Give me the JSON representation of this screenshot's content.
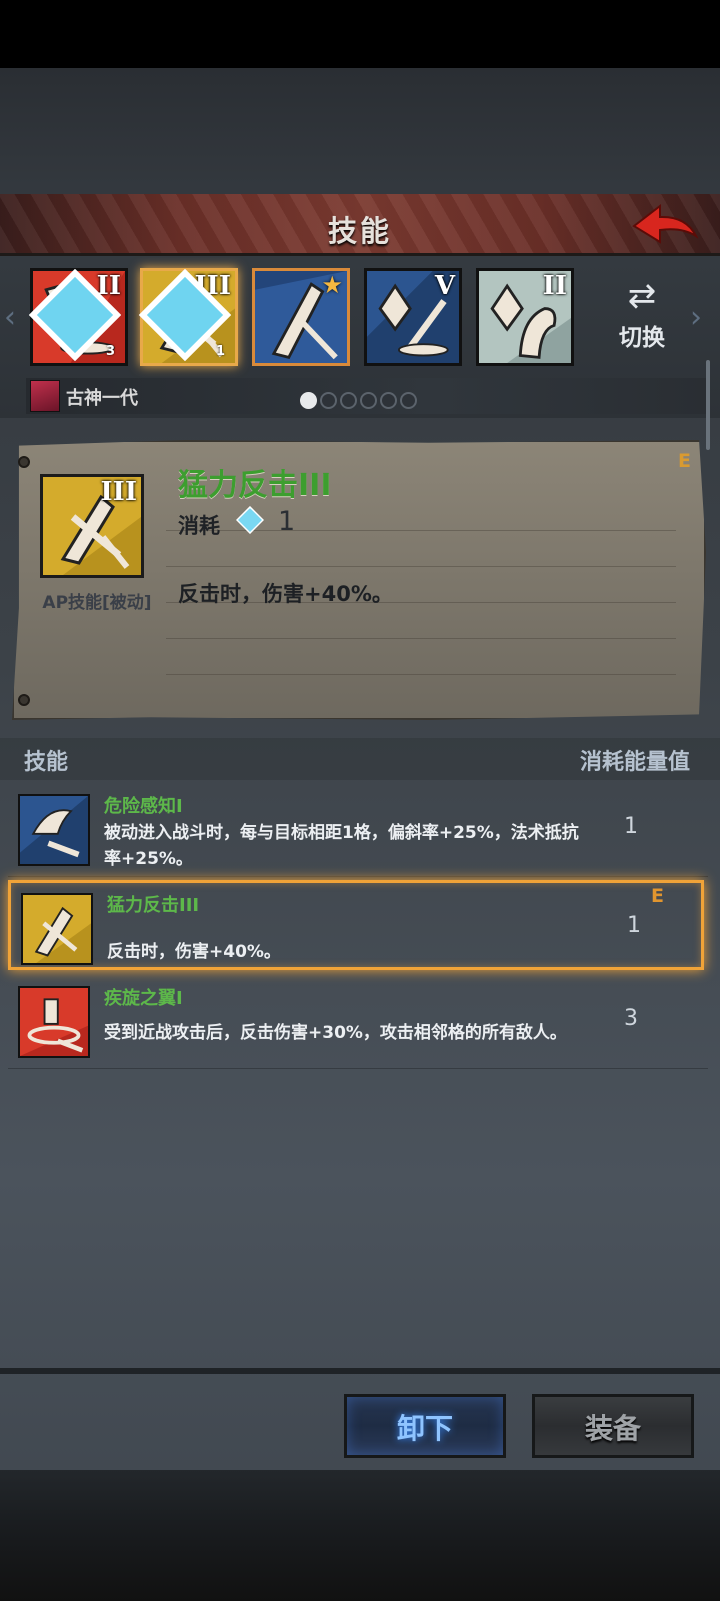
{
  "header": {
    "title": "技能"
  },
  "slots": [
    {
      "numeral": "II",
      "gem": "3",
      "theme": "red"
    },
    {
      "numeral": "III",
      "gem": "1",
      "theme": "gold"
    },
    {
      "numeral": "",
      "gem": "",
      "theme": "blue",
      "star": "★"
    },
    {
      "numeral": "V",
      "gem": "",
      "theme": "blue"
    },
    {
      "numeral": "II",
      "gem": "",
      "theme": "grey"
    }
  ],
  "switch": {
    "icon": "⇄",
    "label": "切换"
  },
  "character": {
    "name": "古神一代"
  },
  "pager": {
    "total": 6,
    "active": 0
  },
  "detail": {
    "name": "猛力反击III",
    "numeral": "III",
    "type": "AP技能[被动]",
    "cost_label": "消耗",
    "cost": "1",
    "description": "反击时，伤害+40%。",
    "tag": "E"
  },
  "list": {
    "col_skill": "技能",
    "col_cost": "消耗能量值",
    "rows": [
      {
        "name": "危险感知I",
        "desc": "被动进入战斗时，每与目标相距1格，偏斜率+25%，法术抵抗率+25%。",
        "cost": "1",
        "tag": ""
      },
      {
        "name": "猛力反击III",
        "desc": "反击时，伤害+40%。",
        "cost": "1",
        "tag": "E"
      },
      {
        "name": "疾旋之翼I",
        "desc": "受到近战攻击后，反击伤害+30%，攻击相邻格的所有敌人。",
        "cost": "3",
        "tag": ""
      }
    ]
  },
  "buttons": {
    "unequip": "卸下",
    "equip": "装备"
  },
  "colors": {
    "accent_gold": "#e8a94a",
    "skill_name_green": "#5db84a",
    "unequip_blue": "#8fc4ff"
  }
}
